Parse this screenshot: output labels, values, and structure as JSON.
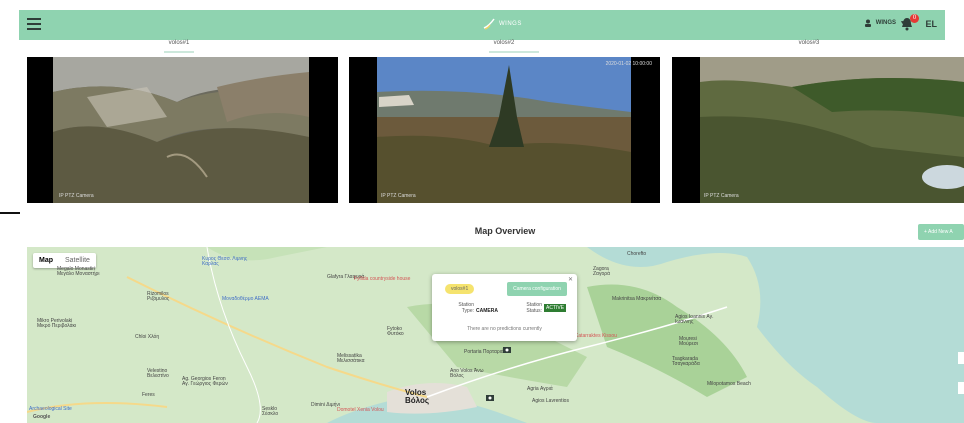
{
  "header": {
    "brand": "WINGS",
    "user": "WINGS",
    "notifications": "0",
    "language": "EL",
    "colors": {
      "bar": "#8fd3b0",
      "accent": "#8fd3b0"
    }
  },
  "tabs": [
    {
      "label": "volos#1"
    },
    {
      "label": "volos#2"
    },
    {
      "label": "volos#3"
    }
  ],
  "cameras": [
    {
      "label": "IP PTZ Camera",
      "timestamp": ""
    },
    {
      "label": "IP PTZ Camera",
      "timestamp": "2020-01-02 10:00:00"
    },
    {
      "label": "IP PTZ Camera",
      "timestamp": ""
    }
  ],
  "map_section": {
    "title": "Map Overview",
    "add_button": "+ Add New A",
    "toggle": {
      "map": "Map",
      "satellite": "Satellite"
    },
    "popup": {
      "tag": "volos#1",
      "config_button": "Camera configuration",
      "station_type_label": "Station Type:",
      "station_type_value": "CAMERA",
      "station_status_label": "Station Status:",
      "station_status_value": "ACTIVE",
      "message": "There are no predictions currently"
    },
    "places": {
      "megalo": "Megalo Monastiri Μεγάλο Μοναστήρι",
      "kyros": "Κυρος Θεσσ. Λιμνης Καρλας",
      "glafyra": "Glafyra Γλαφυρά",
      "fyllida": "Fyllida countryside house",
      "rizomilos": "Rizomilos Ριζόμυλος",
      "mountain_park": "Μοναδοθέρμο ΑΕΜΑ",
      "mikro": "Mikro Perivolaki Μικρό Περιβολάκι",
      "chloi": "Chloi Χλόη",
      "fytoko": "Fytoko Φυτόκο",
      "velestino": "Velestino Βελεστίνο",
      "melissatika": "Melissatika Μελισσάτικα",
      "portaria": "Portaria Πορταριά",
      "makrinitsa": "Makrinitsa Μακρινίτσα",
      "agios_ioannis": "Agios Ioannis Αγ. Ιωάννης",
      "zagora": "Zagora Ζαγορά",
      "katarraktes": "Katarraktes Kissou",
      "tsagkarada": "Tsagkarada Τσαγκαράδα",
      "mouresi": "Mouresi Μούρεσι",
      "ag_georgios": "Ag. Georgios Feron Αγ. Γεώργιος Φερών",
      "feres": "Feres",
      "volos": "Volos Βόλος",
      "ano_volos": "Ano Volos Άνω Βόλος",
      "agria": "Agria Αγριά",
      "lafkos": "Agios Lavrentios",
      "sesklo": "Sesklo Σέσκλο",
      "dimini": "Dimini Διμήνι",
      "domotel": "Domotel Xenia Volou",
      "archaeological": "Archaeological Site",
      "milopotamos": "Milopotamos Beach",
      "chorefto": "Chorefto",
      "google": "Google"
    }
  }
}
